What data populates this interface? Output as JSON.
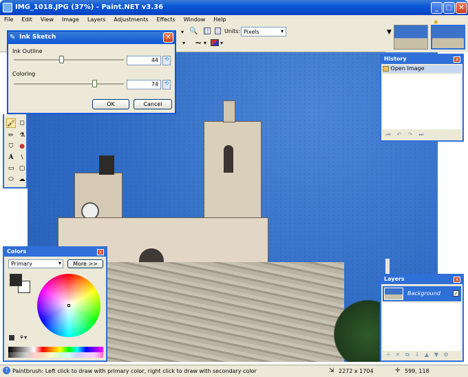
{
  "window": {
    "title": "IMG_1018.JPG (37%) - Paint.NET v3.36",
    "minimize_label": "_",
    "maximize_label": "□",
    "close_label": "✕"
  },
  "menu": [
    "File",
    "Edit",
    "View",
    "Image",
    "Layers",
    "Adjustments",
    "Effects",
    "Window",
    "Help"
  ],
  "toolbar": {
    "units_label": "Units:",
    "units_value": "Pixels"
  },
  "dialog": {
    "title": "Ink Sketch",
    "close_label": "✕",
    "ink_outline_label": "Ink Outline",
    "ink_outline_value": "44",
    "ink_outline_fraction": 0.44,
    "coloring_label": "Coloring",
    "coloring_value": "74",
    "coloring_fraction": 0.74,
    "ok_label": "OK",
    "cancel_label": "Cancel"
  },
  "history": {
    "title": "History",
    "close_label": "✕",
    "items": [
      "Open Image"
    ]
  },
  "layers": {
    "title": "Layers",
    "close_label": "✕",
    "items": [
      {
        "name": "Background",
        "visible": true
      }
    ]
  },
  "colors": {
    "title": "Colors",
    "close_label": "✕",
    "mode": "Primary",
    "more_label": "More >>",
    "primary_color": "#2a2a2a",
    "secondary_color": "#ffffff"
  },
  "status": {
    "hint": "Paintbrush: Left click to draw with primary color, right click to draw with secondary color",
    "image_size": "2272 x 1704",
    "cursor": "599, 118"
  },
  "colors_theme": {
    "accent": "#2f6fd8",
    "title_blue": "#0a57d8",
    "sky": "#2d6ac3"
  }
}
